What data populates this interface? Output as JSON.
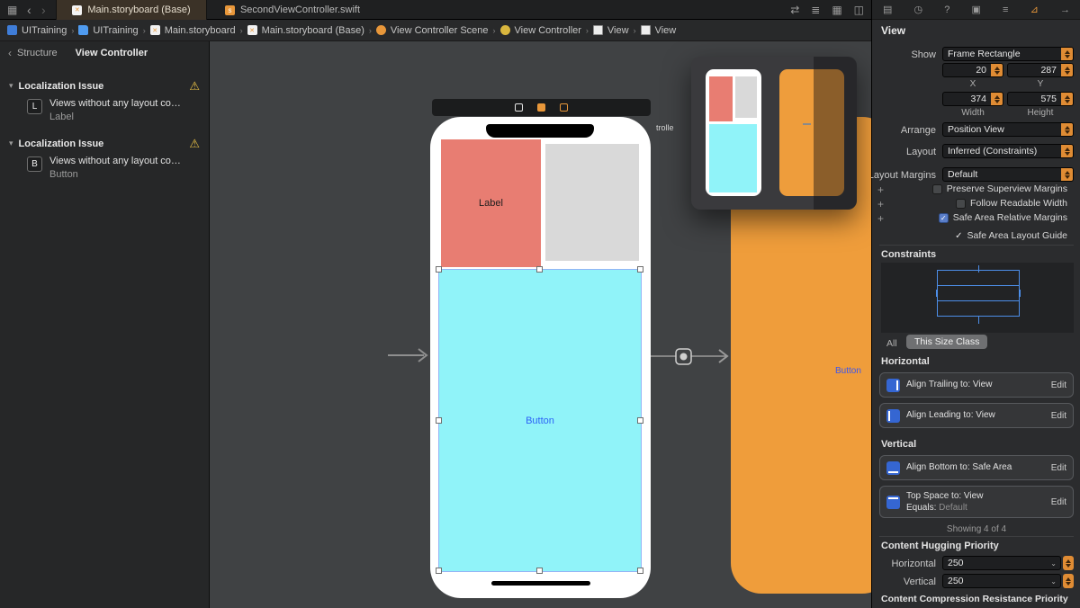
{
  "colors": {
    "accent_orange": "#e8973a",
    "selection_blue": "#4d8ee8",
    "label_view_bg": "#e87d72",
    "gray_view_bg": "#d9d9d9",
    "button_view_bg": "#90f3f9",
    "second_vc_bg": "#ee9d3c",
    "warning_yellow": "#e7bf45",
    "button_text_blue": "#2d63f6"
  },
  "icons": {
    "editor_grid": "▦",
    "back_chevron": "‹",
    "forward_chevron": "›",
    "crumb_chevron": "›",
    "structure_chevron": "‹",
    "warning": "⚠",
    "disclosure": "▾",
    "swap_arrows": "⇄",
    "list_lines": "≣",
    "panel_right": "◫",
    "file": "▤",
    "history": "◷",
    "help": "?",
    "identity": "▣",
    "attributes": "≡",
    "size_ruler": "⊿",
    "connections": "→",
    "check": "✓",
    "popup_chevron": "⌄",
    "storyboard_glyph": "✕",
    "swift_glyph": "s"
  },
  "tabbar": {
    "tabs": [
      {
        "label": "Main.storyboard (Base)"
      },
      {
        "label": "SecondViewController.swift"
      }
    ]
  },
  "jumpbar": {
    "items": [
      {
        "label": "UITraining"
      },
      {
        "label": "UITraining"
      },
      {
        "label": "Main.storyboard"
      },
      {
        "label": "Main.storyboard (Base)"
      },
      {
        "label": "View Controller Scene"
      },
      {
        "label": "View Controller"
      },
      {
        "label": "View"
      },
      {
        "label": "View"
      }
    ]
  },
  "sidebar": {
    "back_label": "Structure",
    "title": "View Controller",
    "sections": [
      {
        "title": "Localization Issue",
        "badge": "L",
        "text": "Views without any layout co…",
        "subtitle": "Label"
      },
      {
        "title": "Localization Issue",
        "badge": "B",
        "text": "Views without any layout co…",
        "subtitle": "Button"
      }
    ]
  },
  "canvas": {
    "label_view_text": "Label",
    "button_view_text": "Button",
    "second_vc_button_text": "Button",
    "clipped_scene_title": "trolle"
  },
  "inspector": {
    "title": "View",
    "show": {
      "label": "Show",
      "value": "Frame Rectangle"
    },
    "frame": {
      "x": {
        "label": "X",
        "value": "20"
      },
      "y": {
        "label": "Y",
        "value": "287"
      },
      "width": {
        "label": "Width",
        "value": "374"
      },
      "height": {
        "label": "Height",
        "value": "575"
      }
    },
    "arrange": {
      "label": "Arrange",
      "value": "Position View"
    },
    "layout": {
      "label": "Layout",
      "value": "Inferred (Constraints)"
    },
    "margins": {
      "label": "Layout Margins",
      "value": "Default"
    },
    "checkboxes": [
      {
        "label": "Preserve Superview Margins",
        "checked": false
      },
      {
        "label": "Follow Readable Width",
        "checked": false
      },
      {
        "label": "Safe Area Relative Margins",
        "checked": true
      },
      {
        "label": "Safe Area Layout Guide",
        "checked": true
      }
    ],
    "constraints_title": "Constraints",
    "size_class": {
      "all": "All",
      "this": "This Size Class"
    },
    "horizontal_title": "Horizontal",
    "vertical_title": "Vertical",
    "constraint_rows": [
      {
        "text": "Align Trailing to:  View",
        "edit": "Edit"
      },
      {
        "text": "Align Leading to:  View",
        "edit": "Edit"
      },
      {
        "text": "Align Bottom to:  Safe Area",
        "edit": "Edit"
      },
      {
        "line1": "Top Space to:  View",
        "line2_label": "Equals:",
        "line2_value": "Default",
        "edit": "Edit"
      }
    ],
    "showing": "Showing 4 of 4",
    "hugging": {
      "title": "Content Hugging Priority",
      "h_label": "Horizontal",
      "h_value": "250",
      "v_label": "Vertical",
      "v_value": "250"
    },
    "compression_title": "Content Compression Resistance Priority"
  }
}
